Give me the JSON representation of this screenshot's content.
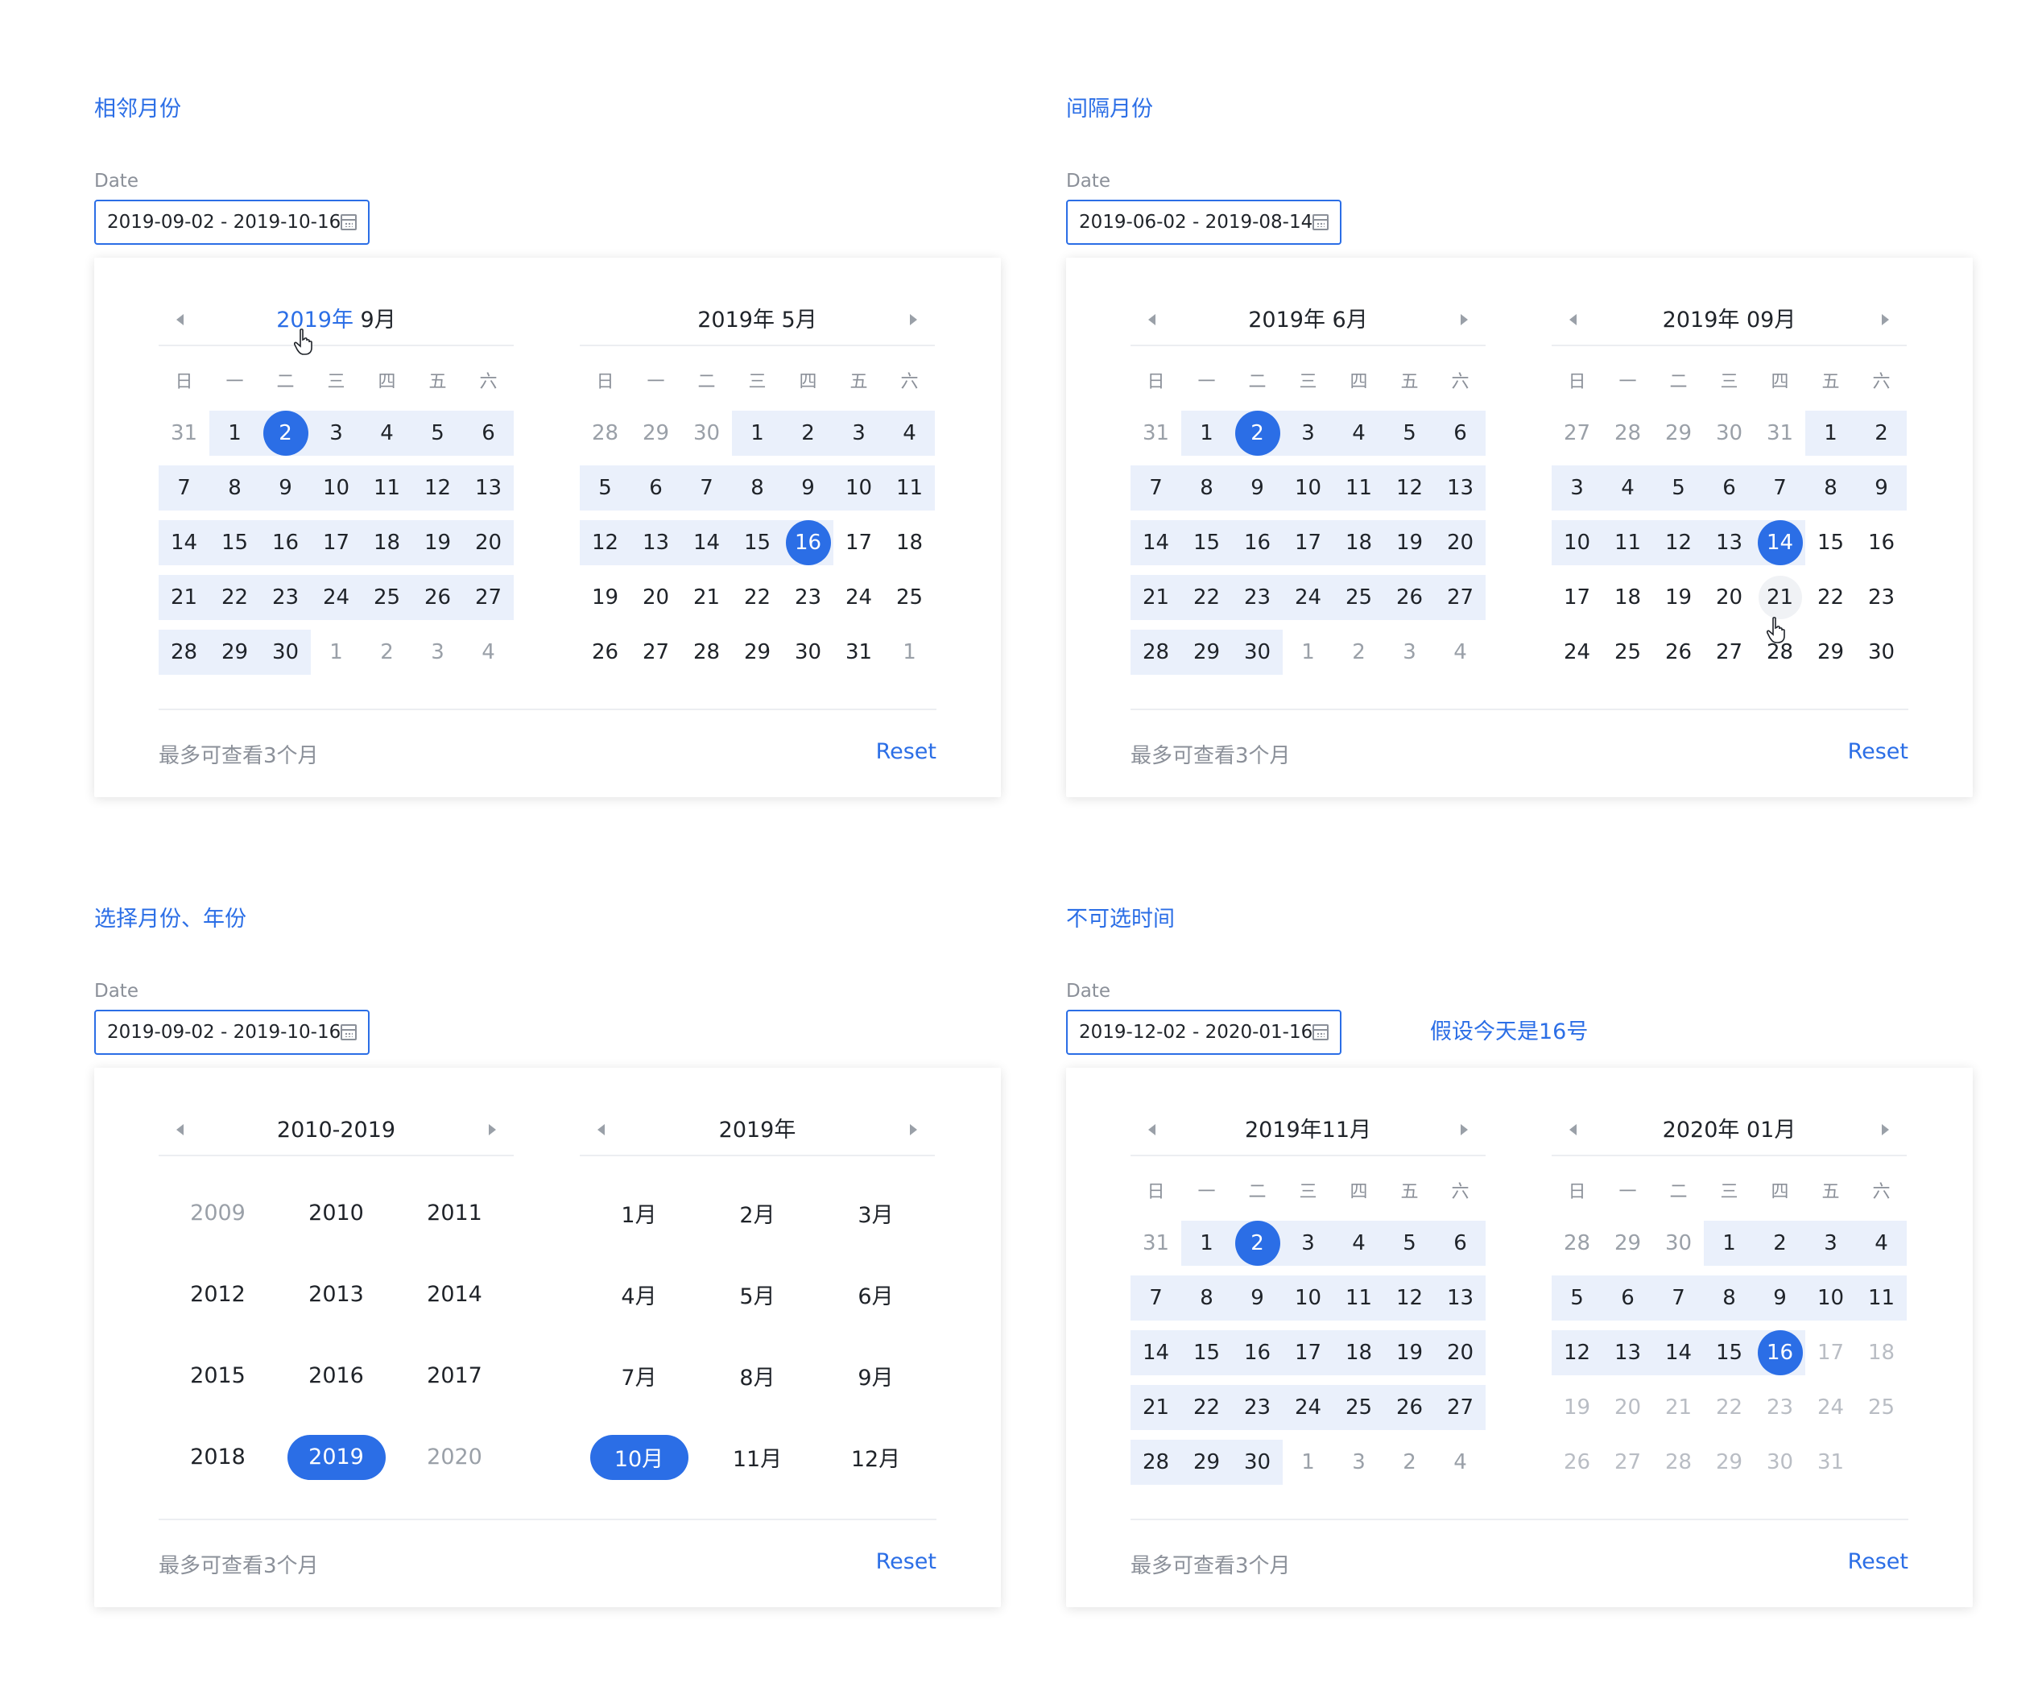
{
  "sections": [
    {
      "title": "相邻月份",
      "label": "Date",
      "value": "2019-09-02 - 2019-10-16",
      "left": {
        "title_hl": "2019年",
        "title_rest": " 9月",
        "days": [
          "31",
          "1",
          "2",
          "3",
          "4",
          "5",
          "6",
          "7",
          "8",
          "9",
          "10",
          "11",
          "12",
          "13",
          "14",
          "15",
          "16",
          "17",
          "18",
          "19",
          "20",
          "21",
          "22",
          "23",
          "24",
          "25",
          "26",
          "27",
          "28",
          "29",
          "30",
          "1",
          "2",
          "3",
          "4"
        ]
      },
      "right": {
        "title": "2019年 5月",
        "days": [
          "28",
          "29",
          "30",
          "1",
          "2",
          "3",
          "4",
          "5",
          "6",
          "7",
          "8",
          "9",
          "10",
          "11",
          "12",
          "13",
          "14",
          "15",
          "16",
          "17",
          "18",
          "19",
          "20",
          "21",
          "22",
          "23",
          "24",
          "25",
          "26",
          "27",
          "28",
          "29",
          "30",
          "31",
          "1"
        ]
      },
      "tip": "最多可查看3个月",
      "reset": "Reset"
    },
    {
      "title": "间隔月份",
      "label": "Date",
      "value": "2019-06-02 - 2019-08-14",
      "left": {
        "title": "2019年 6月",
        "days": [
          "31",
          "1",
          "2",
          "3",
          "4",
          "5",
          "6",
          "7",
          "8",
          "9",
          "10",
          "11",
          "12",
          "13",
          "14",
          "15",
          "16",
          "17",
          "18",
          "19",
          "20",
          "21",
          "22",
          "23",
          "24",
          "25",
          "26",
          "27",
          "28",
          "29",
          "30",
          "1",
          "2",
          "3",
          "4"
        ]
      },
      "right": {
        "title": "2019年 09月",
        "days": [
          "27",
          "28",
          "29",
          "30",
          "31",
          "1",
          "2",
          "3",
          "4",
          "5",
          "6",
          "7",
          "8",
          "9",
          "10",
          "11",
          "12",
          "13",
          "14",
          "15",
          "16",
          "17",
          "18",
          "19",
          "20",
          "21",
          "22",
          "23",
          "24",
          "25",
          "26",
          "27",
          "28",
          "29",
          "30"
        ]
      },
      "tip": "最多可查看3个月",
      "reset": "Reset"
    },
    {
      "title": "选择月份、年份",
      "label": "Date",
      "value": "2019-09-02 - 2019-10-16",
      "left": {
        "title": "2010-2019",
        "items": [
          "2009",
          "2010",
          "2011",
          "2012",
          "2013",
          "2014",
          "2015",
          "2016",
          "2017",
          "2018",
          "2019",
          "2020"
        ]
      },
      "right": {
        "title": "2019年",
        "items": [
          "1月",
          "2月",
          "3月",
          "4月",
          "5月",
          "6月",
          "7月",
          "8月",
          "9月",
          "10月",
          "11月",
          "12月"
        ]
      },
      "tip": "最多可查看3个月",
      "reset": "Reset"
    },
    {
      "title": "不可选时间",
      "label": "Date",
      "value": "2019-12-02 - 2020-01-16",
      "note": "假设今天是16号",
      "left": {
        "title": "2019年11月",
        "days": [
          "31",
          "1",
          "2",
          "3",
          "4",
          "5",
          "6",
          "7",
          "8",
          "9",
          "10",
          "11",
          "12",
          "13",
          "14",
          "15",
          "16",
          "17",
          "18",
          "19",
          "20",
          "21",
          "22",
          "23",
          "24",
          "25",
          "26",
          "27",
          "28",
          "29",
          "30",
          "1",
          "3",
          "2",
          "4"
        ]
      },
      "right": {
        "title": "2020年 01月",
        "days": [
          "28",
          "29",
          "30",
          "1",
          "2",
          "3",
          "4",
          "5",
          "6",
          "7",
          "8",
          "9",
          "10",
          "11",
          "12",
          "13",
          "14",
          "15",
          "16",
          "17",
          "18",
          "19",
          "20",
          "21",
          "22",
          "23",
          "24",
          "25",
          "26",
          "27",
          "28",
          "29",
          "30",
          "31",
          ""
        ]
      },
      "tip": "最多可查看3个月",
      "reset": "Reset"
    }
  ],
  "weekdays": [
    "日",
    "一",
    "二",
    "三",
    "四",
    "五",
    "六"
  ],
  "colors": {
    "primary": "#2b6ee6",
    "range": "#eaf0fb",
    "muted": "#8b9099"
  }
}
